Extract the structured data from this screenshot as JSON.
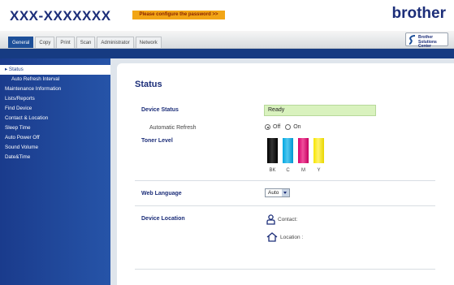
{
  "header": {
    "model": "XXX-XXXXXXX",
    "warning": "Please configure the password >>",
    "brand": "brother"
  },
  "tabs": [
    "General",
    "Copy",
    "Print",
    "Scan",
    "Administrator",
    "Network"
  ],
  "active_tab": "General",
  "solutions_center": {
    "line1": "Brother",
    "line2": "Solutions Center"
  },
  "sidebar": {
    "items": [
      {
        "label": "▸ Status",
        "active": true
      },
      {
        "label": "Auto Refresh Interval",
        "sub": true
      },
      {
        "label": "Maintenance Information"
      },
      {
        "label": "Lists/Reports"
      },
      {
        "label": "Find Device"
      },
      {
        "label": "Contact & Location"
      },
      {
        "label": "Sleep Time"
      },
      {
        "label": "Auto Power Off"
      },
      {
        "label": "Sound Volume"
      },
      {
        "label": "Date&Time"
      }
    ]
  },
  "main": {
    "title": "Status",
    "device_status_label": "Device Status",
    "device_status_value": "Ready",
    "auto_refresh_label": "Automatic Refresh",
    "auto_refresh_off": "Off",
    "auto_refresh_on": "On",
    "auto_refresh_selected": "Off",
    "toner_label": "Toner Level",
    "toner": [
      {
        "name": "BK",
        "color": "#000000"
      },
      {
        "name": "C",
        "color": "#00a7e1"
      },
      {
        "name": "M",
        "color": "#d7006b"
      },
      {
        "name": "Y",
        "color": "#f6e400"
      }
    ],
    "web_language_label": "Web Language",
    "web_language_value": "Auto",
    "device_location_label": "Device Location",
    "contact_label": "Contact:",
    "location_label": "Location :"
  },
  "colors": {
    "brand_blue": "#1c2e79",
    "sidebar_blue": "#1a3b8c",
    "warning_orange": "#f2a516",
    "ready_green": "#d9f2be"
  }
}
